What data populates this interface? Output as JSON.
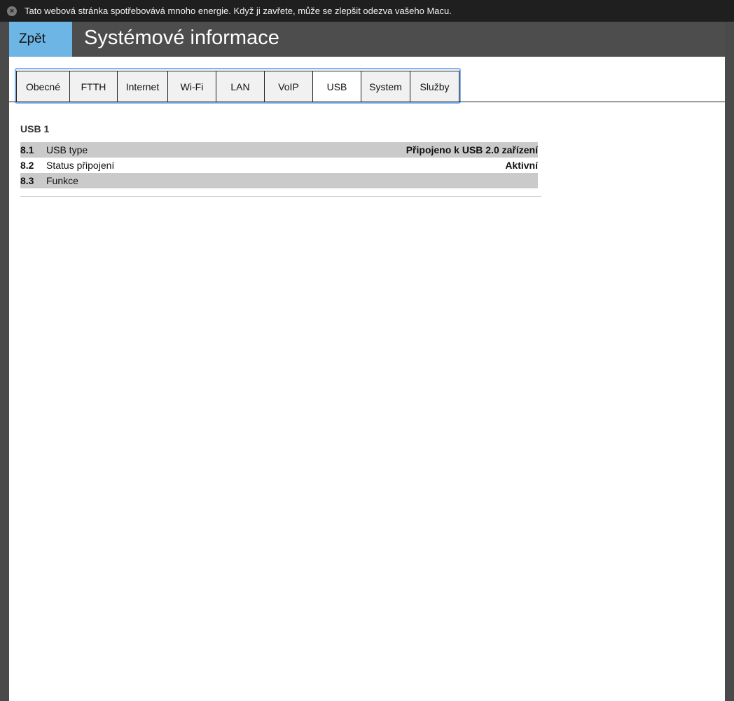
{
  "banner": {
    "close_icon": "close-circle-icon",
    "message": "Tato webová stránka spotřebovává mnoho energie. Když ji zavřete, může se zlepšit odezva vašeho Macu."
  },
  "header": {
    "back_label": "Zpět",
    "title": "Systémové informace",
    "back_color": "#6cb5e4",
    "bar_color": "#4d4d4d"
  },
  "tabs": [
    {
      "label": "Obecné"
    },
    {
      "label": "FTTH"
    },
    {
      "label": "Internet"
    },
    {
      "label": "Wi-Fi"
    },
    {
      "label": "LAN"
    },
    {
      "label": "VoIP"
    },
    {
      "label": "USB",
      "active": true
    },
    {
      "label": "System"
    },
    {
      "label": "Služby"
    }
  ],
  "section": {
    "title": "USB 1",
    "rows": [
      {
        "num": "8.1",
        "label": "USB type",
        "value": "Připojeno k USB 2.0 zařízení"
      },
      {
        "num": "8.2",
        "label": "Status připojení",
        "value": "Aktivní"
      },
      {
        "num": "8.3",
        "label": "Funkce",
        "value": ""
      }
    ]
  }
}
